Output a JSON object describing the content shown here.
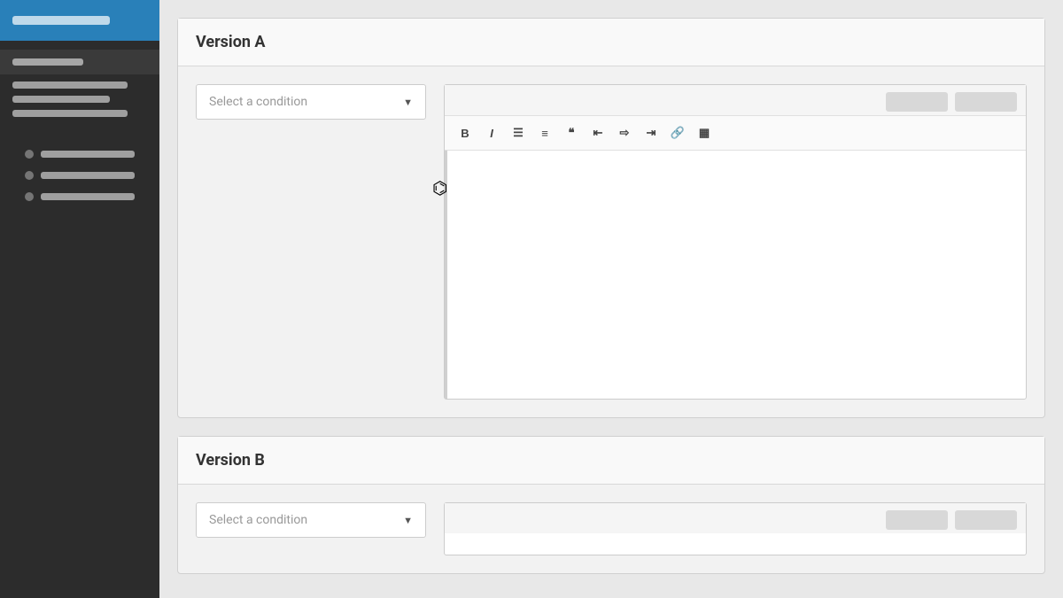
{
  "sidebar": {
    "header_bar_label": "header-bar",
    "active_item_label": "active-item",
    "items": [
      {
        "label": "item-1",
        "width": "short"
      },
      {
        "label": "item-2",
        "width": "medium"
      },
      {
        "label": "item-3",
        "width": "long"
      }
    ],
    "radio_items": [
      {
        "label": "radio-1",
        "width": "long"
      },
      {
        "label": "radio-2",
        "width": "medium"
      },
      {
        "label": "radio-3",
        "width": "medium"
      }
    ]
  },
  "versions": [
    {
      "id": "a",
      "title": "Version A",
      "condition_placeholder": "Select a condition",
      "toolbar_buttons": [
        "B",
        "I",
        "≡",
        "≡",
        "❝",
        "≡",
        "≡",
        "≡",
        "🔗",
        "▦"
      ],
      "btn1_label": "",
      "btn2_label": ""
    },
    {
      "id": "b",
      "title": "Version B",
      "condition_placeholder": "Select a condition",
      "btn1_label": "",
      "btn2_label": ""
    }
  ]
}
